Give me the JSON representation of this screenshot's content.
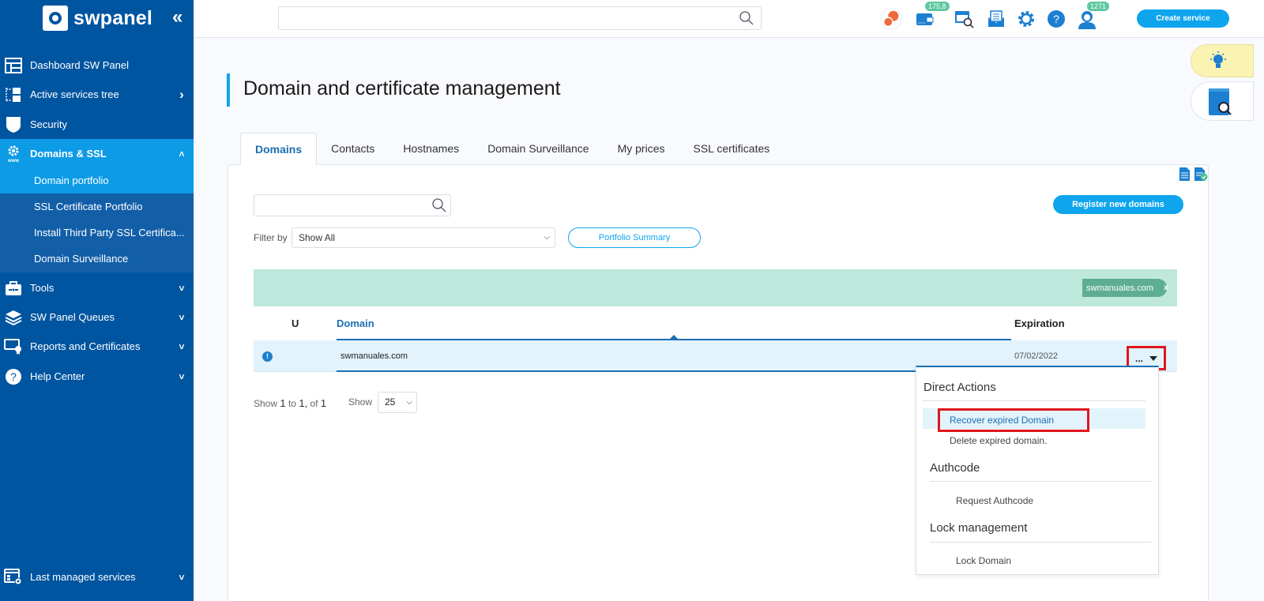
{
  "app": {
    "brand": "swpanel",
    "collapse_icon": "«"
  },
  "sidebar": {
    "items": [
      {
        "label": "Dashboard SW Panel",
        "icon": "dashboard-icon",
        "chevron": ""
      },
      {
        "label": "Active services tree",
        "icon": "tree-icon",
        "chevron": "›"
      },
      {
        "label": "Security",
        "icon": "shield-icon",
        "chevron": ""
      },
      {
        "label": "Domains & SSL",
        "icon": "gear-www-icon",
        "chevron": "˄"
      },
      {
        "label": "Tools",
        "icon": "toolbox-icon",
        "chevron": "˅"
      },
      {
        "label": "SW Panel Queues",
        "icon": "layers-icon",
        "chevron": "˅"
      },
      {
        "label": "Reports and Certificates",
        "icon": "certificate-icon",
        "chevron": "˅"
      },
      {
        "label": "Help Center",
        "icon": "help-icon",
        "chevron": "˅"
      },
      {
        "label": "Last managed services",
        "icon": "window-gear-icon",
        "chevron": "˅"
      }
    ],
    "sub_items": [
      {
        "label": "Domain portfolio",
        "active": true
      },
      {
        "label": "SSL Certificate Portfolio"
      },
      {
        "label": "Install Third Party SSL Certifica..."
      },
      {
        "label": "Domain Surveillance"
      }
    ]
  },
  "topbar": {
    "search_placeholder": "",
    "wallet_badge": "175,8",
    "support_badge": "1271",
    "create_service": "Create service"
  },
  "page": {
    "title": "Domain and certificate management",
    "tabs": [
      "Domains",
      "Contacts",
      "Hostnames",
      "Domain Surveillance",
      "My prices",
      "SSL certificates"
    ],
    "active_tab": "Domains"
  },
  "toolbar": {
    "search_placeholder": "",
    "filter_label": "Filter by",
    "filter_value": "Show All",
    "portfolio_summary": "Portfolio Summary",
    "register_new_domains": "Register new domains",
    "active_filter_chip": "swmanuales.com",
    "chip_close": "x"
  },
  "table": {
    "columns": [
      "U",
      "Domain",
      "Expiration"
    ],
    "rows": [
      {
        "status": "!",
        "domain": "swmanuales.com",
        "expiration": "07/02/2022",
        "actions": "..."
      }
    ]
  },
  "pagination": {
    "prefix": "Show",
    "from": "1",
    "to_word": "to",
    "to": "1,",
    "of_word": "of",
    "total": "1",
    "show_label": "Show",
    "page_size": "25"
  },
  "actions_menu": {
    "sections": [
      {
        "title": "Direct Actions",
        "items": [
          "Recover expired Domain",
          "Delete expired domain."
        ]
      },
      {
        "title": "Authcode",
        "items": [
          "Request Authcode"
        ]
      },
      {
        "title": "Lock management",
        "items": [
          "Lock Domain"
        ]
      }
    ],
    "highlighted_item": "Recover expired Domain"
  },
  "colors": {
    "sidebar": "#0055a0",
    "accent": "#0ea5ed",
    "active_nav": "#0d9be6",
    "highlight": "#e0161e",
    "chip": "#5fae92"
  }
}
